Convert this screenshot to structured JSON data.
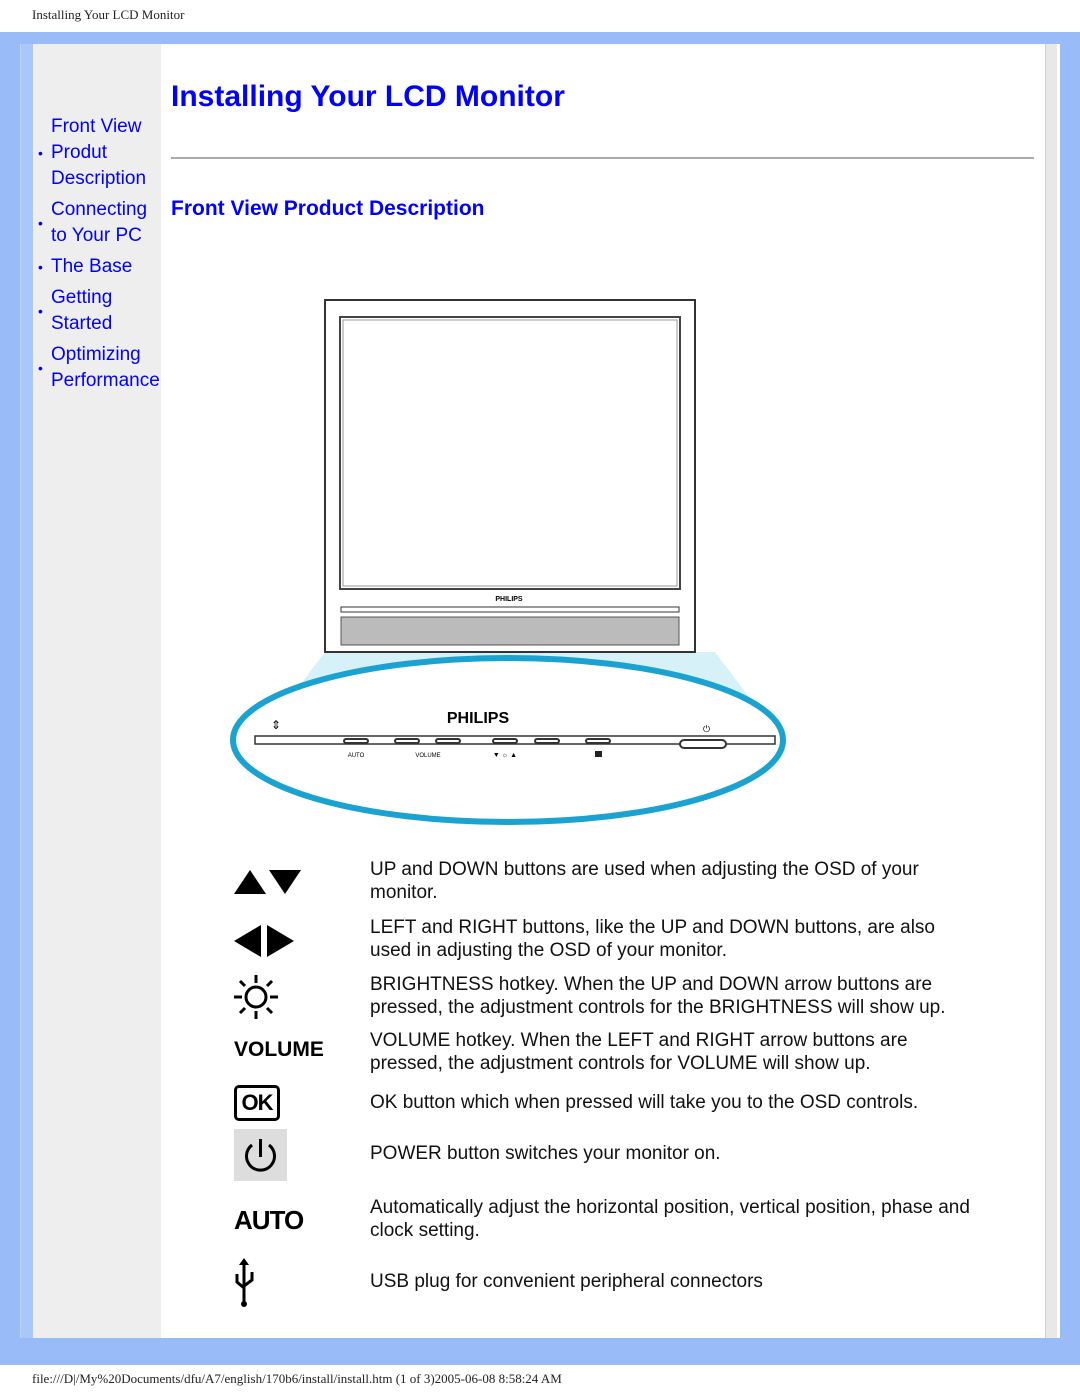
{
  "window_title": "Installing Your LCD Monitor",
  "footer": "file:///D|/My%20Documents/dfu/A7/english/170b6/install/install.htm (1 of 3)2005-06-08 8:58:24 AM",
  "sidebar": {
    "items": [
      {
        "label": "Front View Produt Description",
        "lines": [
          "Front View",
          "Produt",
          "Description"
        ]
      },
      {
        "label": "Connecting to Your PC",
        "lines": [
          "Connecting",
          "to Your PC"
        ]
      },
      {
        "label": "The Base",
        "lines": [
          "The Base"
        ]
      },
      {
        "label": "Getting Started",
        "lines": [
          "Getting",
          "Started"
        ]
      },
      {
        "label": "Optimizing Performance",
        "lines": [
          "Optimizing",
          "Performance"
        ]
      }
    ]
  },
  "page_title": "Installing Your LCD Monitor",
  "section_title": "Front View Product Description",
  "diagram": {
    "brand": "PHILIPS",
    "labels": [
      "AUTO",
      "VOLUME"
    ]
  },
  "features": [
    {
      "icon": "up-down-arrows-icon",
      "text": "UP and DOWN buttons are used when adjusting the OSD of your monitor."
    },
    {
      "icon": "left-right-arrows-icon",
      "text": "LEFT and RIGHT buttons, like the UP and DOWN buttons, are also used in adjusting the OSD of your monitor."
    },
    {
      "icon": "brightness-icon",
      "text": "BRIGHTNESS hotkey. When the UP and DOWN arrow buttons are pressed, the adjustment controls for the BRIGHTNESS will show up."
    },
    {
      "icon": "volume-label",
      "label": "VOLUME",
      "text": "VOLUME hotkey. When the LEFT and RIGHT arrow buttons are pressed, the adjustment controls for VOLUME will show up."
    },
    {
      "icon": "ok-icon",
      "label": "OK",
      "text": "OK button which when pressed will take you to the OSD controls."
    },
    {
      "icon": "power-icon",
      "text": "POWER button switches your monitor on."
    },
    {
      "icon": "auto-label",
      "label": "AUTO",
      "text": "Automatically adjust the horizontal position, vertical position, phase and clock setting."
    },
    {
      "icon": "usb-icon",
      "text": "USB plug for convenient peripheral connectors"
    }
  ],
  "colors": {
    "link": "#0000ff",
    "frame": "#99bbf8",
    "sidebar": "#eeeeee",
    "ellipse": "#1aa3d1"
  }
}
